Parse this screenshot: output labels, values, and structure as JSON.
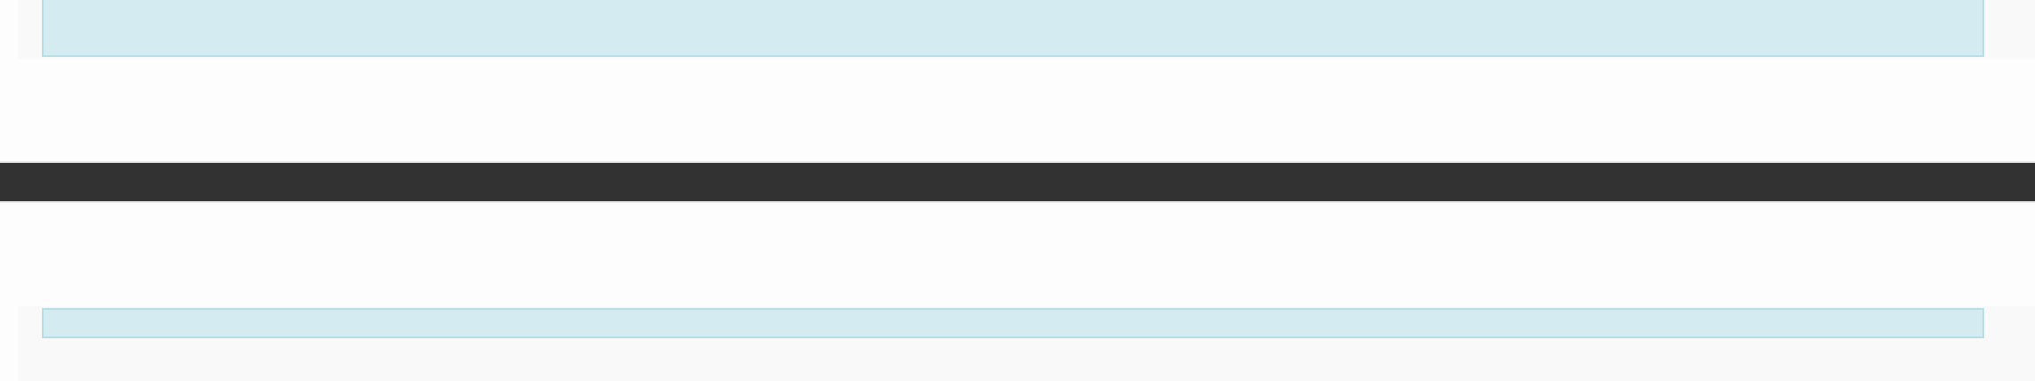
{
  "top_alert": {
    "text": "",
    "background_color": "#d4ecf1",
    "border_color": "#b7dde5",
    "text_color": "#2e6a8a"
  },
  "footer_bar": {
    "background_color": "#323232"
  },
  "bottom_alert": {
    "text": "",
    "background_color": "#d4ecf1",
    "border_color": "#b7dde5"
  }
}
